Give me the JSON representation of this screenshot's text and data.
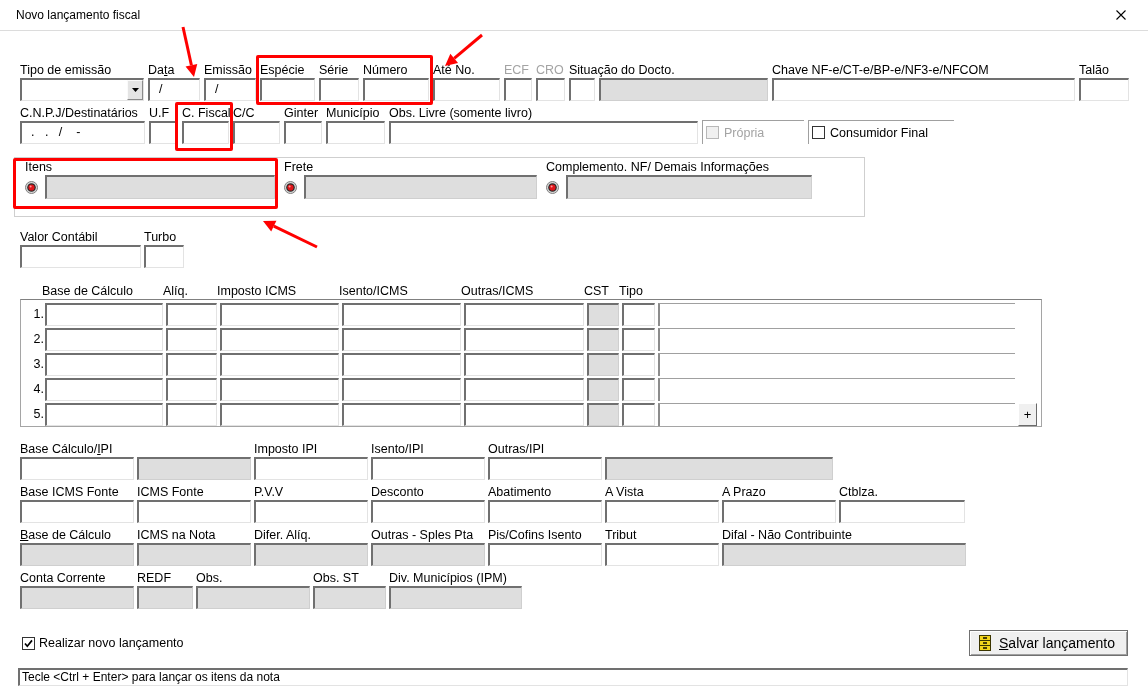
{
  "window": {
    "title": "Novo lançamento fiscal"
  },
  "document_row": [
    {
      "kind": "select",
      "label": "Tipo de emissão",
      "label_dimmed": false,
      "disabled": false
    },
    {
      "kind": "text",
      "label": [
        {
          "text": "Da",
          "underline": false
        },
        {
          "text": "t",
          "underline": true
        },
        {
          "text": "a",
          "underline": false
        }
      ],
      "label_dimmed": false,
      "disabled": false,
      "value": "/"
    },
    {
      "kind": "text",
      "label": "Emissão",
      "label_dimmed": false,
      "disabled": false,
      "value": "/"
    },
    {
      "kind": "text",
      "label": "Espécie",
      "label_dimmed": false,
      "disabled": false
    },
    {
      "kind": "text",
      "label": "Série",
      "label_dimmed": false,
      "disabled": false
    },
    {
      "kind": "text",
      "label": "Número",
      "label_dimmed": false,
      "disabled": false
    },
    {
      "kind": "text",
      "label": "Até No.",
      "label_dimmed": false,
      "disabled": false
    },
    {
      "kind": "text",
      "label": "ECF",
      "label_dimmed": true,
      "disabled": false
    },
    {
      "kind": "text",
      "label": "CRO",
      "label_dimmed": true,
      "disabled": false
    },
    {
      "kind": "text",
      "label": "Situação do Docto.",
      "label_dimmed": false,
      "disabled": false
    },
    {
      "kind": "text",
      "disabled": true
    },
    {
      "kind": "text",
      "label": "Chave NF-e/CT-e/BP-e/NF3-e/NFCOM",
      "label_dimmed": false,
      "disabled": false
    },
    {
      "kind": "text",
      "label": "Talão",
      "label_dimmed": false,
      "disabled": false
    }
  ],
  "party_row": {
    "fields": [
      {
        "label": "C.N.P.J/Destinatários",
        "disabled": false,
        "value": ".   .   /    -"
      },
      {
        "label": "U.F",
        "disabled": false
      },
      {
        "label": "C. Fiscal",
        "disabled": false
      },
      {
        "label": "C/C",
        "disabled": false
      },
      {
        "label": "Ginter",
        "disabled": false
      },
      {
        "label": "Município",
        "disabled": false
      },
      {
        "label": "Obs. Livre (somente livro)",
        "disabled": false
      }
    ],
    "options": [
      {
        "label": "Própria",
        "checked": false,
        "disabled": true
      },
      {
        "label": "Consumidor Final",
        "checked": false,
        "disabled": false
      }
    ]
  },
  "info_links": [
    {
      "label": "Itens",
      "disabled": true
    },
    {
      "label": "Frete",
      "disabled": true
    },
    {
      "label": "Complemento. NF/ Demais Informações",
      "disabled": true
    }
  ],
  "totals_row": [
    {
      "label": "Valor Contábil",
      "disabled": false
    },
    {
      "label": "Turbo",
      "disabled": false
    }
  ],
  "icms_table": {
    "columns": [
      {
        "label": "Base de Cálculo",
        "disabled": false
      },
      {
        "label": "Alíq.",
        "disabled": false
      },
      {
        "label": "Imposto ICMS",
        "disabled": false
      },
      {
        "label": "Isento/ICMS",
        "disabled": false
      },
      {
        "label": "Outras/ICMS",
        "disabled": false
      },
      {
        "label": "CST",
        "disabled": true
      },
      {
        "label": "Tipo",
        "disabled": false
      },
      {
        "disabled": false
      }
    ],
    "rows": [
      {
        "number": "1."
      },
      {
        "number": "2."
      },
      {
        "number": "3."
      },
      {
        "number": "4."
      },
      {
        "number": "5."
      }
    ],
    "add_button": "+"
  },
  "summary_rows": [
    {
      "fields": [
        {
          "label": [
            {
              "text": "Base Cálculo/",
              "underline": false
            },
            {
              "text": "I",
              "underline": true
            },
            {
              "text": "PI",
              "underline": false
            }
          ],
          "disabled": false
        },
        {
          "disabled": true
        },
        {
          "label": "Imposto IPI",
          "disabled": false
        },
        {
          "label": "Isento/IPI",
          "disabled": false
        },
        {
          "label": "Outras/IPI",
          "disabled": false
        },
        {
          "disabled": true
        }
      ]
    },
    {
      "fields": [
        {
          "label": "Base ICMS Fonte",
          "disabled": false
        },
        {
          "label": "ICMS Fonte",
          "disabled": false
        },
        {
          "label": "P.V.V",
          "disabled": false
        },
        {
          "label": "Desconto",
          "disabled": false
        },
        {
          "label": "Abatimento",
          "disabled": false
        },
        {
          "label": "A Vista",
          "disabled": false
        },
        {
          "label": "A Prazo",
          "disabled": false
        },
        {
          "label": "Ctblza.",
          "disabled": false
        }
      ]
    },
    {
      "fields": [
        {
          "label": [
            {
              "text": "B",
              "underline": true
            },
            {
              "text": "ase de Cálculo",
              "underline": false
            }
          ],
          "disabled": true
        },
        {
          "label": "ICMS na Nota",
          "disabled": true
        },
        {
          "label": "Difer. Alíq.",
          "disabled": true
        },
        {
          "label": "Outras - Sples Pta",
          "disabled": true
        },
        {
          "label": "Pis/Cofins Isento",
          "disabled": false
        },
        {
          "label": "Tribut",
          "disabled": false
        },
        {
          "label": "Difal - Não Contribuinte",
          "disabled": true
        }
      ]
    },
    {
      "fields": [
        {
          "label": "Conta Corrente",
          "disabled": true
        },
        {
          "label": "REDF",
          "disabled": true
        },
        {
          "label": "Obs.",
          "disabled": true
        },
        {
          "label": "Obs. ST",
          "disabled": true
        },
        {
          "label": "Div. Municípios (IPM)",
          "disabled": true
        }
      ]
    }
  ],
  "new_entry": {
    "label": "Realizar novo lançamento",
    "checked": true
  },
  "save_button": {
    "label": [
      {
        "text": "S",
        "underline": true
      },
      {
        "text": "alvar lançamento",
        "underline": false
      }
    ]
  },
  "status_bar": {
    "text": "Tecle <Ctrl + Enter> para lançar os itens da nota"
  },
  "annotations": [
    {
      "kind": "frame"
    },
    {
      "kind": "frame"
    },
    {
      "kind": "frame"
    },
    {
      "kind": "arrow"
    },
    {
      "kind": "arrow"
    },
    {
      "kind": "arrow"
    }
  ]
}
